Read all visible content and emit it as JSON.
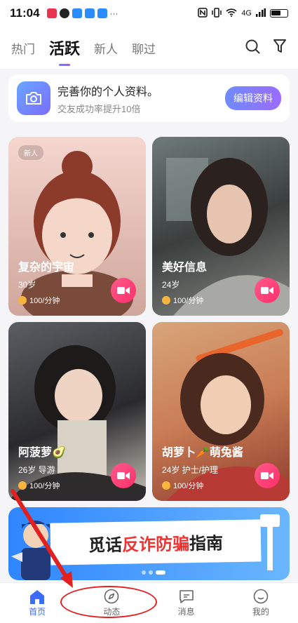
{
  "status": {
    "time": "11:04",
    "network": "4G"
  },
  "tabs": [
    {
      "label": "热门"
    },
    {
      "label": "活跃"
    },
    {
      "label": "新人"
    },
    {
      "label": "聊过"
    }
  ],
  "profile_banner": {
    "title": "完善你的个人资料。",
    "subtitle": "交友成功率提升10倍",
    "button": "编辑资料"
  },
  "cards": [
    {
      "badge": "新人",
      "name": "复杂的宇宙",
      "meta": "30岁",
      "price": "100/分钟"
    },
    {
      "name": "美好信息",
      "meta": "24岁",
      "price": "100/分钟"
    },
    {
      "name": "阿菠萝🥑",
      "meta": "26岁  导游",
      "price": "100/分钟"
    },
    {
      "name": "胡萝卜🥕萌兔酱",
      "meta": "24岁  护士/护理",
      "price": "100/分钟"
    }
  ],
  "promo": {
    "prefix": "觅话",
    "highlight": "反诈防骗",
    "suffix": "指南"
  },
  "bottom_nav": [
    {
      "label": "首页",
      "icon": "home-icon"
    },
    {
      "label": "动态",
      "icon": "compass-icon"
    },
    {
      "label": "消息",
      "icon": "message-icon"
    },
    {
      "label": "我的",
      "icon": "profile-icon"
    }
  ],
  "colors": {
    "accent": "#3b6bff",
    "video": "#ff2f6a",
    "annotation": "#e32020"
  }
}
